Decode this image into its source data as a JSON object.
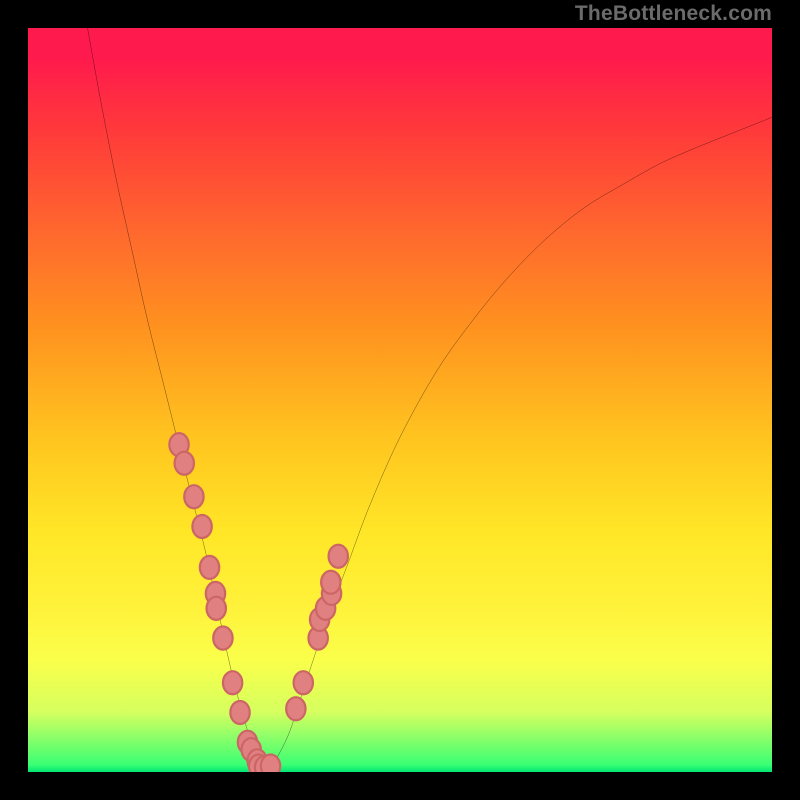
{
  "watermark": "TheBottleneck.com",
  "colors": {
    "frame": "#000000",
    "gradient_top": "#ff1a4d",
    "gradient_mid": "#ffe727",
    "gradient_bottom": "#00e673",
    "curve": "#000000",
    "dot_fill": "#e08080",
    "dot_stroke": "#cc6666"
  },
  "chart_data": {
    "type": "line",
    "title": "",
    "xlabel": "",
    "ylabel": "",
    "xlim": [
      0,
      100
    ],
    "ylim": [
      0,
      100
    ],
    "grid": false,
    "legend": false,
    "series": [
      {
        "name": "curve",
        "x": [
          8,
          10,
          12,
          14,
          16,
          18,
          20,
          22,
          24,
          25.5,
          27,
          28.5,
          30,
          31,
          32,
          33,
          35,
          37,
          40,
          43,
          46,
          50,
          55,
          60,
          65,
          70,
          75,
          80,
          85,
          90,
          95,
          100
        ],
        "y": [
          100,
          89,
          79,
          70,
          61,
          53,
          45,
          37,
          29,
          22,
          15,
          9,
          4,
          1.2,
          0.3,
          1.2,
          5,
          11,
          20,
          28,
          36,
          45,
          54,
          61,
          67,
          72,
          76,
          79,
          81.8,
          84,
          86,
          88
        ]
      }
    ],
    "points": [
      {
        "name": "left-cluster",
        "x": [
          20.3,
          21.0,
          22.3,
          23.4,
          24.4,
          25.2,
          25.3,
          26.2,
          27.5,
          28.5,
          29.5,
          30.0,
          30.8,
          31.0,
          31.8,
          32.6
        ],
        "y": [
          44.0,
          41.5,
          37.0,
          33.0,
          27.5,
          24.0,
          22.0,
          18.0,
          12.0,
          8.0,
          4.0,
          3.0,
          1.5,
          0.8,
          0.6,
          0.8
        ]
      },
      {
        "name": "right-cluster",
        "x": [
          36.0,
          37.0,
          39.0,
          39.2,
          40.0,
          40.8,
          40.7,
          41.7
        ],
        "y": [
          8.5,
          12.0,
          18.0,
          20.5,
          22.0,
          24.0,
          25.5,
          29.0
        ]
      }
    ]
  }
}
